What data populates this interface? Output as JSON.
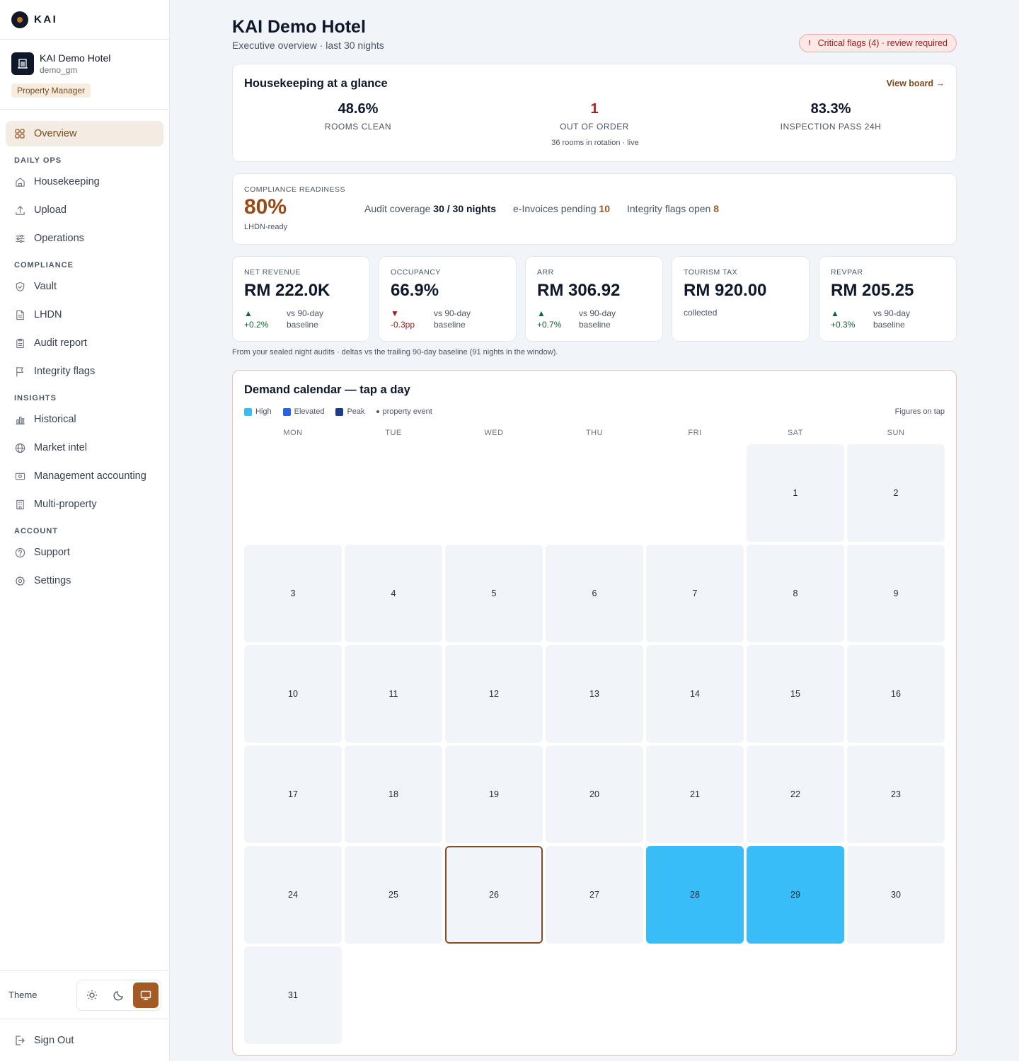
{
  "brand": {
    "name": "KAI"
  },
  "property": {
    "name": "KAI Demo Hotel",
    "user": "demo_gm",
    "role": "Property Manager"
  },
  "nav": {
    "overview": "Overview",
    "sections": [
      {
        "title": "DAILY OPS",
        "items": [
          {
            "label": "Housekeeping",
            "icon": "home-icon"
          },
          {
            "label": "Upload",
            "icon": "upload-icon"
          },
          {
            "label": "Operations",
            "icon": "sliders-icon"
          }
        ]
      },
      {
        "title": "COMPLIANCE",
        "items": [
          {
            "label": "Vault",
            "icon": "shield-icon"
          },
          {
            "label": "LHDN",
            "icon": "document-icon"
          },
          {
            "label": "Audit report",
            "icon": "clipboard-icon"
          },
          {
            "label": "Integrity flags",
            "icon": "flag-icon"
          }
        ]
      },
      {
        "title": "INSIGHTS",
        "items": [
          {
            "label": "Historical",
            "icon": "bar-chart-icon"
          },
          {
            "label": "Market intel",
            "icon": "globe-icon"
          },
          {
            "label": "Management accounting",
            "icon": "banknote-icon"
          },
          {
            "label": "Multi-property",
            "icon": "building-icon"
          }
        ]
      },
      {
        "title": "ACCOUNT",
        "items": [
          {
            "label": "Support",
            "icon": "help-circle-icon"
          },
          {
            "label": "Settings",
            "icon": "gear-icon"
          }
        ]
      }
    ]
  },
  "theme": {
    "label": "Theme",
    "selected": "system"
  },
  "signout": "Sign Out",
  "header": {
    "title": "KAI Demo Hotel",
    "subtitle": "Executive overview · last 30 nights",
    "critical": "Critical flags (4) · review required",
    "critical_icon": "!"
  },
  "housekeeping": {
    "title": "Housekeeping at a glance",
    "view_board": "View board →",
    "stats": [
      {
        "value": "48.6%",
        "label": "ROOMS CLEAN"
      },
      {
        "value": "1",
        "label": "OUT OF ORDER"
      },
      {
        "value": "83.3%",
        "label": "INSPECTION PASS 24H"
      }
    ],
    "note": "36 rooms in rotation · live"
  },
  "compliance": {
    "label": "COMPLIANCE READINESS",
    "value": "80%",
    "sub": "LHDN-ready",
    "audit_label": "Audit coverage",
    "audit_value": "30 / 30 nights",
    "einv_label": "e-Invoices pending",
    "einv_value": "10",
    "flags_label": "Integrity flags open",
    "flags_value": "8"
  },
  "kpis": [
    {
      "label": "NET REVENUE",
      "value": "RM 222.0K",
      "arrow": "▲",
      "delta": "+0.2%",
      "direction": "up",
      "cmp1": "vs 90-day",
      "cmp2": "baseline"
    },
    {
      "label": "OCCUPANCY",
      "value": "66.9%",
      "arrow": "▼",
      "delta": "-0.3pp",
      "direction": "down",
      "cmp1": "vs 90-day",
      "cmp2": "baseline"
    },
    {
      "label": "ARR",
      "value": "RM 306.92",
      "arrow": "▲",
      "delta": "+0.7%",
      "direction": "up",
      "cmp1": "vs 90-day",
      "cmp2": "baseline"
    },
    {
      "label": "TOURISM TAX",
      "value": "RM 920.00",
      "note": "collected"
    },
    {
      "label": "REVPAR",
      "value": "RM 205.25",
      "arrow": "▲",
      "delta": "+0.3%",
      "direction": "up",
      "cmp1": "vs 90-day",
      "cmp2": "baseline"
    }
  ],
  "kpi_footnote": "From your sealed night audits · deltas vs the trailing 90-day baseline (91 nights in the window).",
  "calendar": {
    "title": "Demand calendar — tap a day",
    "legend": [
      {
        "label": "High",
        "color": "#38bdf8"
      },
      {
        "label": "Elevated",
        "color": "#2563eb"
      },
      {
        "label": "Peak",
        "color": "#1e3a8a"
      }
    ],
    "event_label": "property event",
    "figures_note": "Figures on tap",
    "weekdays": [
      "MON",
      "TUE",
      "WED",
      "THU",
      "FRI",
      "SAT",
      "SUN"
    ],
    "first_weekday_index": 5,
    "days_in_month": 31,
    "today": 26,
    "high_days": [
      28,
      29
    ],
    "colors": {
      "high": "#38bdf8",
      "today_border": "#8b4a22"
    }
  }
}
